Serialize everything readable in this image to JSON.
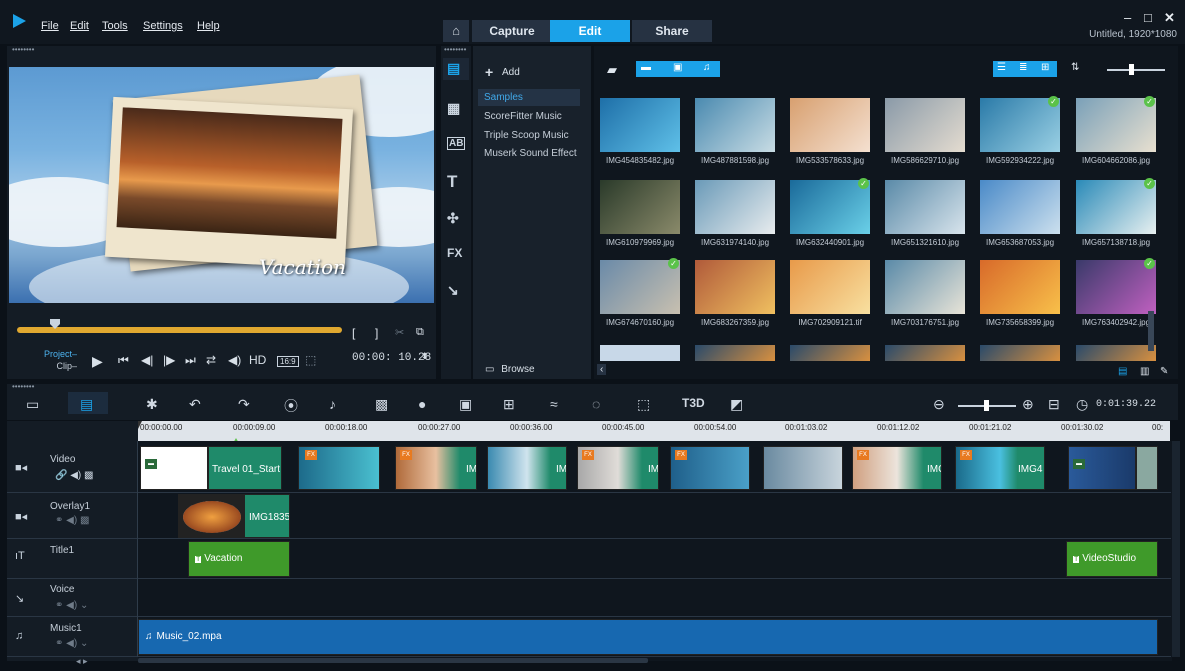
{
  "menu": {
    "file": "File",
    "edit": "Edit",
    "tools": "Tools",
    "settings": "Settings",
    "help": "Help"
  },
  "tabs": {
    "capture": "Capture",
    "edit": "Edit",
    "share": "Share"
  },
  "window": {
    "title": "Untitled, 1920*1080"
  },
  "player": {
    "overlay_text": "Vacation",
    "project_label": "Project–",
    "clip_label": "Clip–",
    "hd_label": "HD",
    "ratio_label": "16:9",
    "timecode": "00:00: 10.28"
  },
  "library": {
    "add_label": "Add",
    "browse_label": "Browse",
    "folders": [
      "Samples",
      "ScoreFitter Music",
      "Triple Scoop Music",
      "Muserk Sound Effect"
    ],
    "thumbnails": [
      "IMG454835482.jpg",
      "IMG487881598.jpg",
      "IMG533578633.jpg",
      "IMG586629710.jpg",
      "IMG592934222.jpg",
      "IMG604662086.jpg",
      "IMG610979969.jpg",
      "IMG631974140.jpg",
      "IMG632440901.jpg",
      "IMG651321610.jpg",
      "IMG653687053.jpg",
      "IMG657138718.jpg",
      "IMG674670160.jpg",
      "IMG683267359.jpg",
      "IMG702909121.tif",
      "IMG703176751.jpg",
      "IMG735658399.jpg",
      "IMG763402942.jpg"
    ]
  },
  "timeline": {
    "timecode": "0:01:39.22",
    "ruler": [
      "00:00:00.00",
      "00:00:09.00",
      "00:00:18.00",
      "00:00:27.00",
      "00:00:36.00",
      "00:00:45.00",
      "00:00:54.00",
      "00:01:03.02",
      "00:01:12.02",
      "00:01:21.02",
      "00:01:30.02",
      "00:"
    ],
    "tracks": [
      "Video",
      "Overlay1",
      "Title1",
      "Voice",
      "Music1"
    ],
    "clips": {
      "video_first": "Travel 01_Start",
      "video_img1": "IM",
      "video_img2": "IM",
      "video_img3": "IM",
      "video_img4": "IMG",
      "video_img5": "IMG4",
      "overlay": "IMG1835",
      "title_a": "Vacation",
      "title_b": "VideoStudio",
      "music": "Music_02.mpa"
    }
  },
  "colors": {
    "accent": "#1ba2e8",
    "scrub": "#e0a830",
    "title_clip": "#3f9a2a",
    "music_clip": "#1768b0",
    "video_clip": "#1f8a6a"
  }
}
